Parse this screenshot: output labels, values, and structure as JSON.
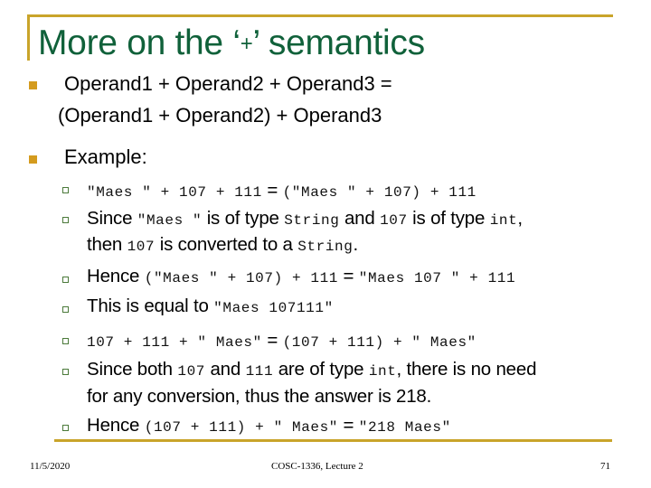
{
  "slide": {
    "title_prefix": "More on the ‘",
    "title_symbol": "+",
    "title_suffix": "’ semantics",
    "bullets": [
      {
        "line1": "Operand1 + Operand2 + Operand3 =",
        "line2": "(Operand1 + Operand2) + Operand3"
      },
      {
        "label": "Example:"
      }
    ],
    "sub_bullets": {
      "s1": {
        "code1": "\"Maes \" + 107 + 111",
        "eq": " = ",
        "code2": "(\"Maes \" + 107) + 111"
      },
      "s2": {
        "t1": "Since ",
        "c1": "\"Maes \"",
        "t2": " is of type ",
        "c2": "String",
        "t3": " and ",
        "c3": "107",
        "t4": " is of type ",
        "c4": "int",
        "t5": ",",
        "t6": "then ",
        "c5": "107",
        "t7": " is converted to a ",
        "c6": "String",
        "t8": "."
      },
      "s3": {
        "t1": "Hence ",
        "c1": "(\"Maes \" + 107) + 111",
        "eq": " = ",
        "c2": "\"Maes 107 \" + 111"
      },
      "s4": {
        "t1": "This is equal to ",
        "c1": "\"Maes 107111\""
      },
      "s5": {
        "code1": "107 + 111 + \" Maes\"",
        "eq": " = ",
        "code2": "(107 + 111) + \" Maes\""
      },
      "s6": {
        "t1": "Since both ",
        "c1": "107",
        "t2": " and ",
        "c2": "111",
        "t3": " are of type ",
        "c3": "int",
        "t4": ", there is no need",
        "t5": "for any conversion, thus the answer is 218."
      },
      "s7": {
        "t1": "Hence ",
        "c1": "(107 + 111) + \" Maes\"",
        "eq": " = ",
        "c2": "\"218 Maes\""
      }
    }
  },
  "footer": {
    "date": "11/5/2020",
    "course": "COSC-1336, Lecture 2",
    "page_number": "71"
  },
  "colors": {
    "title": "#10613a",
    "rule": "#c9a42a",
    "bullet_primary": "#d49b1e",
    "bullet_secondary": "#4b7a3a"
  }
}
